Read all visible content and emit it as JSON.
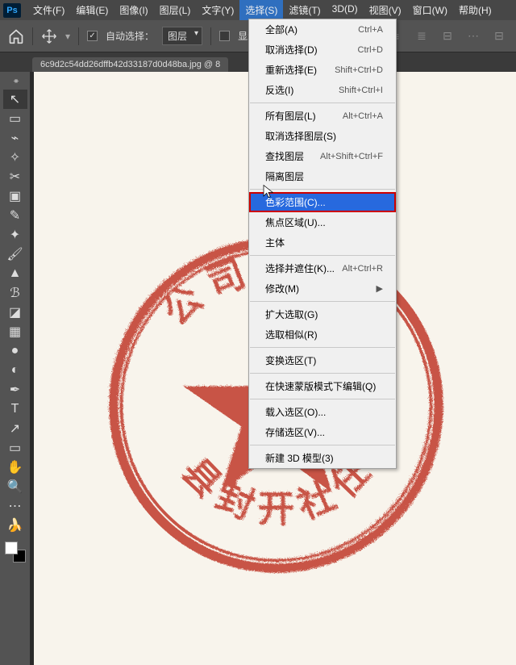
{
  "menubar": {
    "logo": "Ps",
    "items": [
      "文件(F)",
      "编辑(E)",
      "图像(I)",
      "图层(L)",
      "文字(Y)",
      "选择(S)",
      "滤镜(T)",
      "3D(D)",
      "视图(V)",
      "窗口(W)",
      "帮助(H)"
    ],
    "open_index": 5
  },
  "optbar": {
    "auto_select_label": "自动选择：",
    "auto_select_checked": true,
    "combo_value": "图层",
    "show_transform_label": "显示",
    "show_transform_checked": false
  },
  "tab": {
    "filename": "6c9d2c54dd26dffb42d33187d0d48ba.jpg",
    "zoom_suffix": " @ 8"
  },
  "tools": [
    {
      "name": "move",
      "glyph": "↖",
      "active": true
    },
    {
      "name": "marquee",
      "glyph": "▭"
    },
    {
      "name": "lasso",
      "glyph": "⌁"
    },
    {
      "name": "magic-wand",
      "glyph": "✧"
    },
    {
      "name": "crop",
      "glyph": "✂"
    },
    {
      "name": "frame",
      "glyph": "▣"
    },
    {
      "name": "eyedropper",
      "glyph": "✎"
    },
    {
      "name": "spot-heal",
      "glyph": "✦"
    },
    {
      "name": "brush",
      "glyph": "🖌"
    },
    {
      "name": "clone",
      "glyph": "▲"
    },
    {
      "name": "history-brush",
      "glyph": "ℬ"
    },
    {
      "name": "eraser",
      "glyph": "◪"
    },
    {
      "name": "gradient",
      "glyph": "▦"
    },
    {
      "name": "blur",
      "glyph": "●"
    },
    {
      "name": "dodge",
      "glyph": "◐"
    },
    {
      "name": "pen",
      "glyph": "✒"
    },
    {
      "name": "type",
      "glyph": "T"
    },
    {
      "name": "path-select",
      "glyph": "↗"
    },
    {
      "name": "shape",
      "glyph": "▭"
    },
    {
      "name": "hand",
      "glyph": "✋"
    },
    {
      "name": "zoom",
      "glyph": "🔍"
    },
    {
      "name": "edit-toolbar",
      "glyph": "⋯"
    },
    {
      "name": "banana",
      "glyph": "🍌"
    }
  ],
  "dropdown": {
    "sections": [
      [
        {
          "label": "全部(A)",
          "kb": "Ctrl+A"
        },
        {
          "label": "取消选择(D)",
          "kb": "Ctrl+D"
        },
        {
          "label": "重新选择(E)",
          "kb": "Shift+Ctrl+D"
        },
        {
          "label": "反选(I)",
          "kb": "Shift+Ctrl+I"
        }
      ],
      [
        {
          "label": "所有图层(L)",
          "kb": "Alt+Ctrl+A"
        },
        {
          "label": "取消选择图层(S)",
          "kb": ""
        },
        {
          "label": "查找图层",
          "kb": "Alt+Shift+Ctrl+F"
        },
        {
          "label": "隔离图层",
          "kb": ""
        }
      ],
      [
        {
          "label": "色彩范围(C)...",
          "kb": "",
          "highlight": true
        },
        {
          "label": "焦点区域(U)...",
          "kb": ""
        },
        {
          "label": "主体",
          "kb": ""
        }
      ],
      [
        {
          "label": "选择并遮住(K)...",
          "kb": "Alt+Ctrl+R"
        },
        {
          "label": "修改(M)",
          "kb": "",
          "submenu": true
        }
      ],
      [
        {
          "label": "扩大选取(G)",
          "kb": ""
        },
        {
          "label": "选取相似(R)",
          "kb": ""
        }
      ],
      [
        {
          "label": "变换选区(T)",
          "kb": ""
        }
      ],
      [
        {
          "label": "在快速蒙版模式下编辑(Q)",
          "kb": ""
        }
      ],
      [
        {
          "label": "载入选区(O)...",
          "kb": ""
        },
        {
          "label": "存储选区(V)...",
          "kb": ""
        }
      ],
      [
        {
          "label": "新建 3D 模型(3)",
          "kb": ""
        }
      ]
    ]
  },
  "stamp": {
    "color": "#c0392b"
  }
}
